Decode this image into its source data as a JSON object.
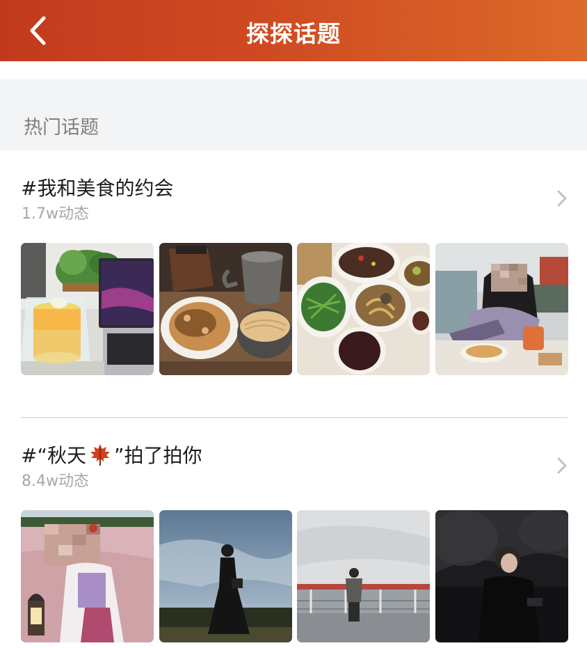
{
  "header": {
    "title": "探探话题",
    "back_icon": "chevron-left-icon"
  },
  "section": {
    "title": "热门话题"
  },
  "topics": [
    {
      "title": "#我和美食的约会",
      "count": "1.7w动态",
      "images": [
        "cake-and-laptop-photo",
        "pancake-and-noodles-photo",
        "dishes-table-photo",
        "woman-cafe-photo"
      ]
    },
    {
      "title_prefix": "#“秋天",
      "title_emoji": "maple-leaf-icon",
      "title_suffix": "”拍了拍你",
      "count": "8.4w动态",
      "images": [
        "girl-pink-grass-photo",
        "woman-black-dress-sky-photo",
        "man-railing-river-photo",
        "man-night-trees-photo"
      ]
    }
  ],
  "colors": {
    "header_start": "#c23a1e",
    "header_end": "#dc6a2a",
    "section_bg": "#f3f4f6",
    "muted_text": "#a7a7a7"
  }
}
